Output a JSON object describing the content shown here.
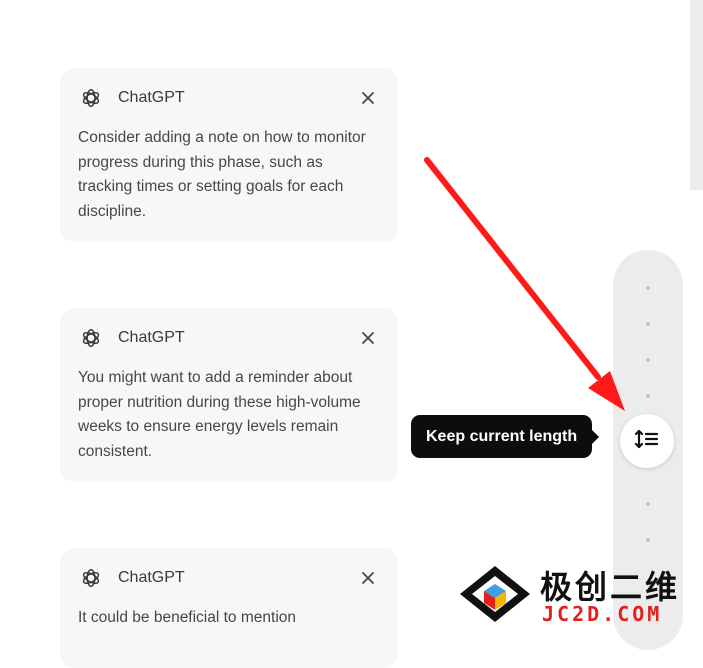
{
  "cards": [
    {
      "title": "ChatGPT",
      "body": "Consider adding a note on how to monitor progress during this phase, such as tracking times or setting goals for each discipline.",
      "close_icon": "close-icon",
      "logo_icon": "chatgpt-logo-icon"
    },
    {
      "title": "ChatGPT",
      "body": "You might want to add a reminder about proper nutrition during these high-volume weeks to ensure energy levels remain consistent.",
      "close_icon": "close-icon",
      "logo_icon": "chatgpt-logo-icon"
    },
    {
      "title": "ChatGPT",
      "body": "It could be beneficial to mention",
      "close_icon": "close-icon",
      "logo_icon": "chatgpt-logo-icon"
    }
  ],
  "length_slider": {
    "tooltip": "Keep current length",
    "handle_icon": "adjust-length-icon"
  },
  "annotation": {
    "arrow_color": "#ff1a1a"
  },
  "watermark": {
    "chinese": "极创二维",
    "domain": "JC2D.COM",
    "accent_color": "#e3201b"
  }
}
